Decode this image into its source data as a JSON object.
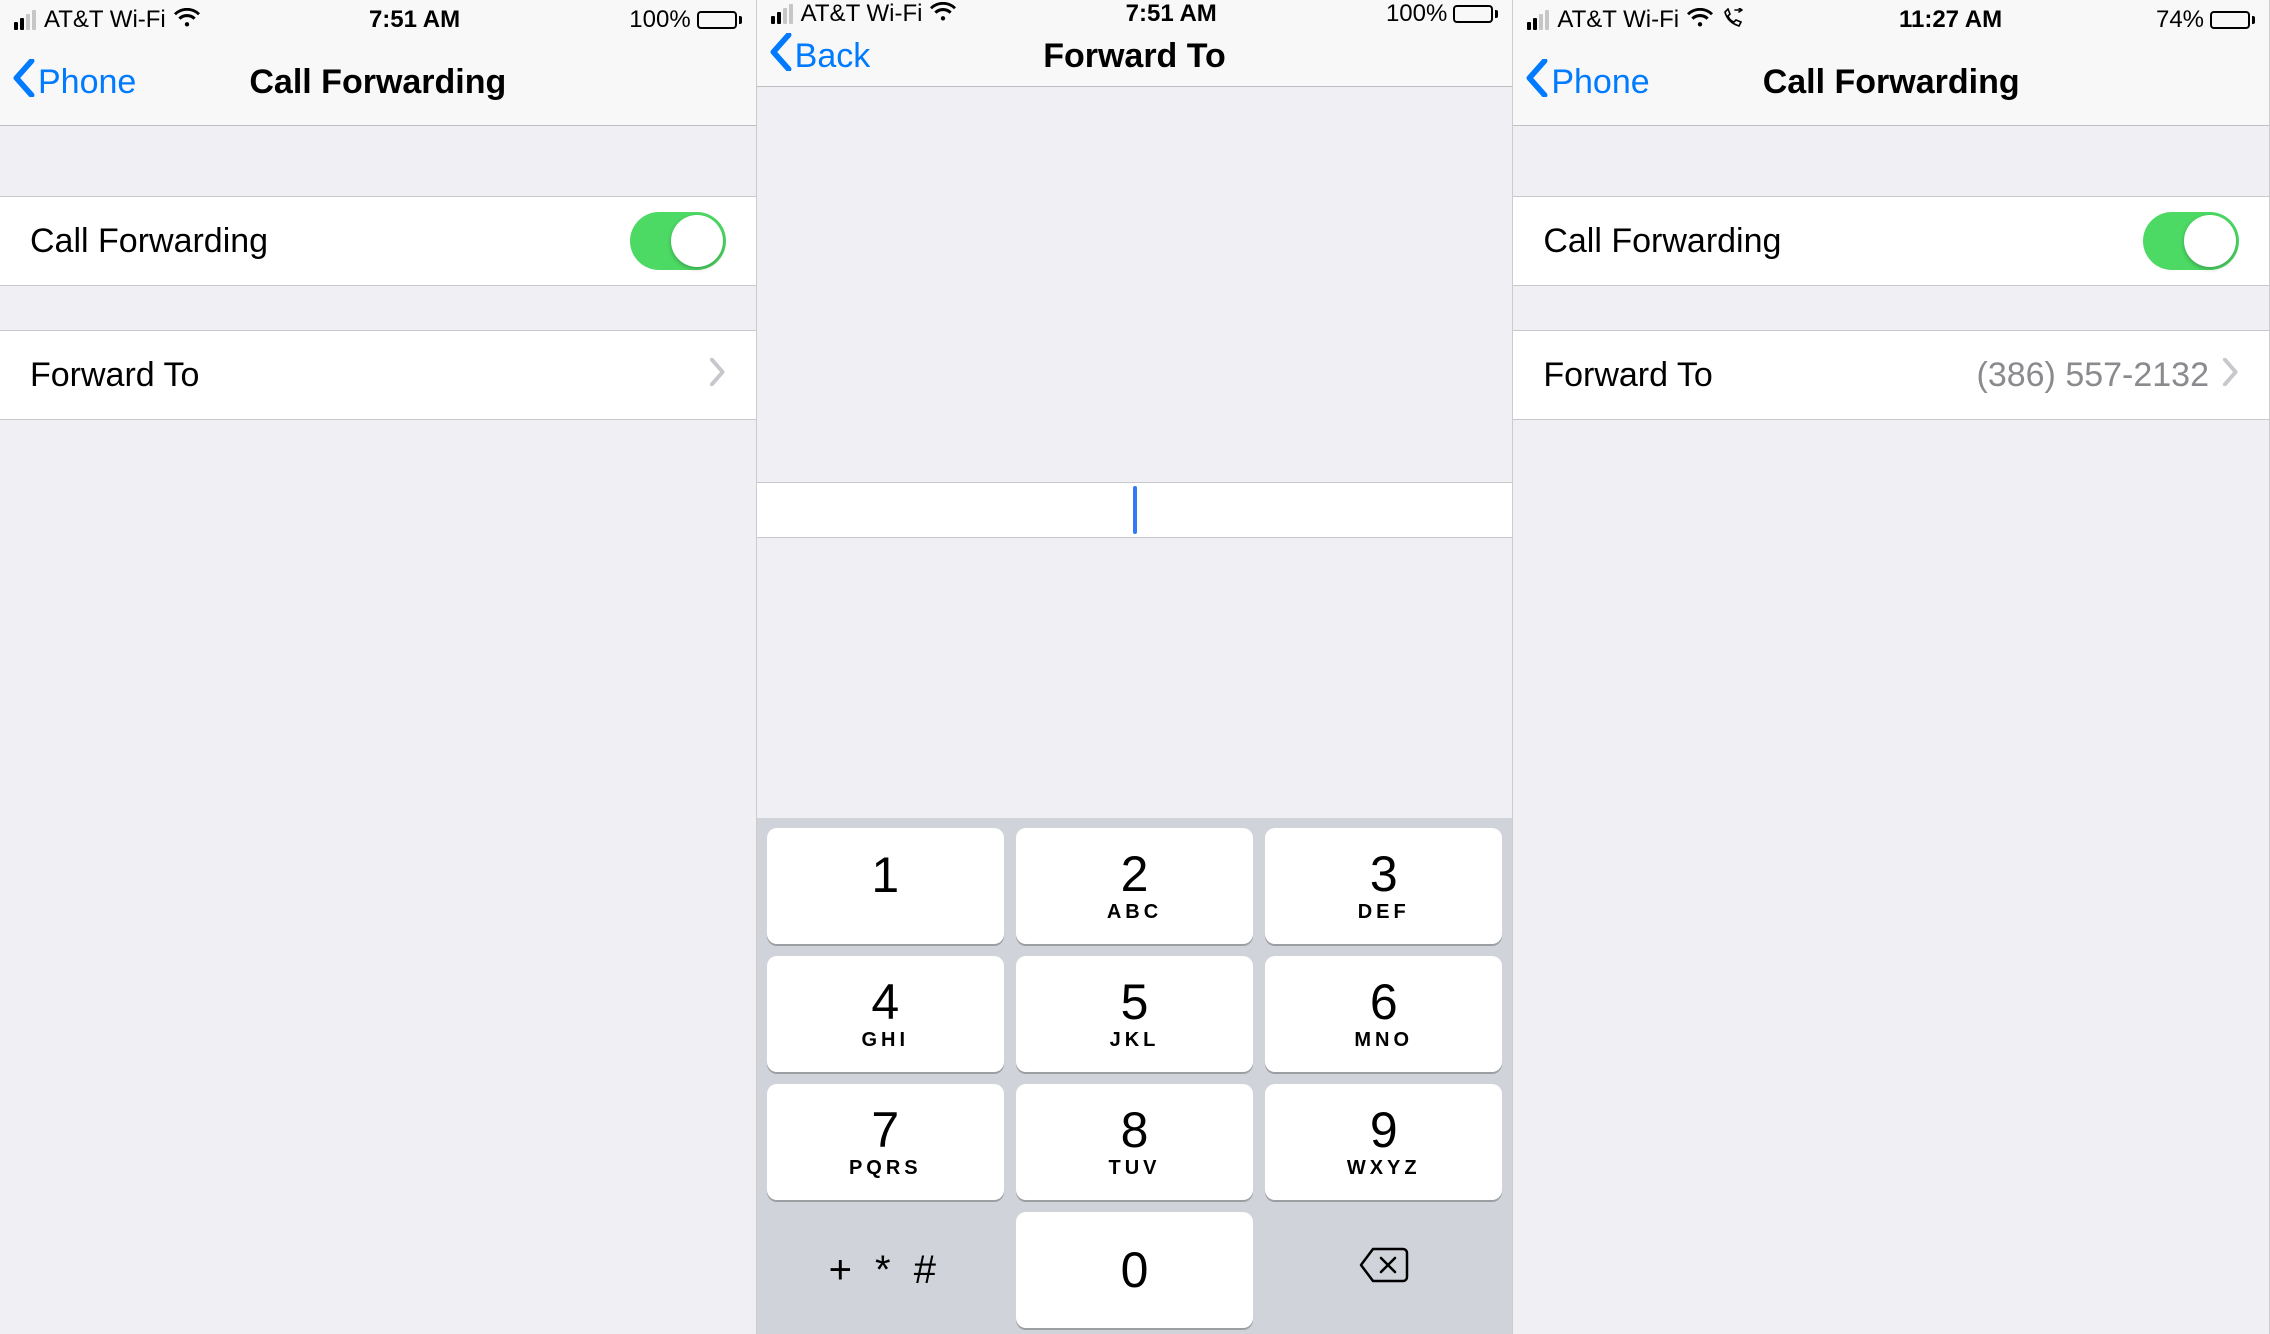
{
  "screens": [
    {
      "status": {
        "carrier": "AT&T Wi-Fi",
        "time": "7:51 AM",
        "battery_text": "100%",
        "battery_pct": 100,
        "bars_on": 2,
        "show_fwd_icon": false
      },
      "nav": {
        "back_label": "Phone",
        "title": "Call Forwarding"
      },
      "rows": {
        "toggle_label": "Call Forwarding",
        "forward_label": "Forward To",
        "forward_value": ""
      }
    },
    {
      "status": {
        "carrier": "AT&T Wi-Fi",
        "time": "7:51 AM",
        "battery_text": "100%",
        "battery_pct": 100,
        "bars_on": 2,
        "show_fwd_icon": false
      },
      "nav": {
        "back_label": "Back",
        "title": "Forward To"
      },
      "input_value": "",
      "keypad": [
        {
          "num": "1",
          "sub": ""
        },
        {
          "num": "2",
          "sub": "ABC"
        },
        {
          "num": "3",
          "sub": "DEF"
        },
        {
          "num": "4",
          "sub": "GHI"
        },
        {
          "num": "5",
          "sub": "JKL"
        },
        {
          "num": "6",
          "sub": "MNO"
        },
        {
          "num": "7",
          "sub": "PQRS"
        },
        {
          "num": "8",
          "sub": "TUV"
        },
        {
          "num": "9",
          "sub": "WXYZ"
        }
      ],
      "key_symbols": "+ * #",
      "key_zero": "0"
    },
    {
      "status": {
        "carrier": "AT&T Wi-Fi",
        "time": "11:27 AM",
        "battery_text": "74%",
        "battery_pct": 74,
        "bars_on": 2,
        "show_fwd_icon": true
      },
      "nav": {
        "back_label": "Phone",
        "title": "Call Forwarding"
      },
      "rows": {
        "toggle_label": "Call Forwarding",
        "forward_label": "Forward To",
        "forward_value": "(386) 557-2132"
      }
    }
  ]
}
